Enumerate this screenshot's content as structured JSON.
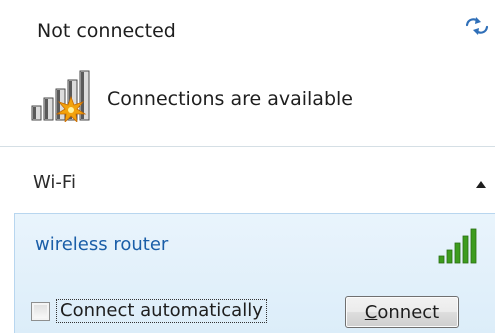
{
  "status": {
    "title": "Not connected",
    "refresh_icon": "refresh-arrows-icon",
    "connections_icon": "signal-bars-with-star-icon",
    "connections_text": "Connections are available"
  },
  "section": {
    "label": "Wi-Fi",
    "toggle_icon": "chevron-up-icon"
  },
  "network": {
    "name": "wireless router",
    "signal_icon": "wifi-signal-bars-icon",
    "auto_connect_label": "Connect automatically",
    "auto_connect_checked": false,
    "connect_accel": "C",
    "connect_rest": "onnect"
  },
  "colors": {
    "network_name": "#1a5ea8",
    "panel_bg": "#e3f0fa",
    "panel_border": "#b8d6ef",
    "signal_green": "#3d9c1e",
    "star": "#f2a20c"
  }
}
